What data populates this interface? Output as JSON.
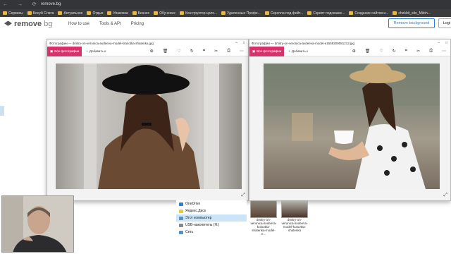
{
  "browser": {
    "url": "remove.bg",
    "bookmarks": [
      "Сервисы",
      "Бонуй Слата",
      "Актуальное",
      "Отдых",
      "Упаковка",
      "Бизнес",
      "Обучение",
      "Конструктор целе...",
      "Удаленные Профе...",
      "Скрепла под фейт...",
      "Скрипт подсказке...",
      "Создание сайтов и...",
      "chekbit_site_Mitoh..."
    ]
  },
  "site": {
    "logo_main": "remove",
    "logo_suffix": "bg",
    "nav": [
      "How to use",
      "Tools & API",
      "Pricing"
    ],
    "remove_button": "Remove background",
    "login_button": "Logi"
  },
  "viewer1": {
    "title": "Фотографии — dmitry-on-veronica-avdeeva-model-krasotka-shatenka.jpg",
    "all_photos": "Все фотографии",
    "add_to": "Добавить к"
  },
  "viewer2": {
    "title": "Фотографии — dmitry-on-veronica-avdeeva-model-e1559209081213.jpg",
    "all_photos": "Все фотографии",
    "add_to": "Добавить к"
  },
  "explorer": {
    "items": [
      "OneDrive",
      "Яндекс.Диск",
      "Этот компьютер",
      "USB-накопитель (H:)",
      "Сеть"
    ]
  },
  "thumbnails": [
    {
      "caption": "dmitry-on-veronica-avdeeva-krasotka-shatenka-model-e..."
    },
    {
      "caption": "dmitry-on-veronica-avdeeva-model-krasotka-shatenka"
    }
  ]
}
